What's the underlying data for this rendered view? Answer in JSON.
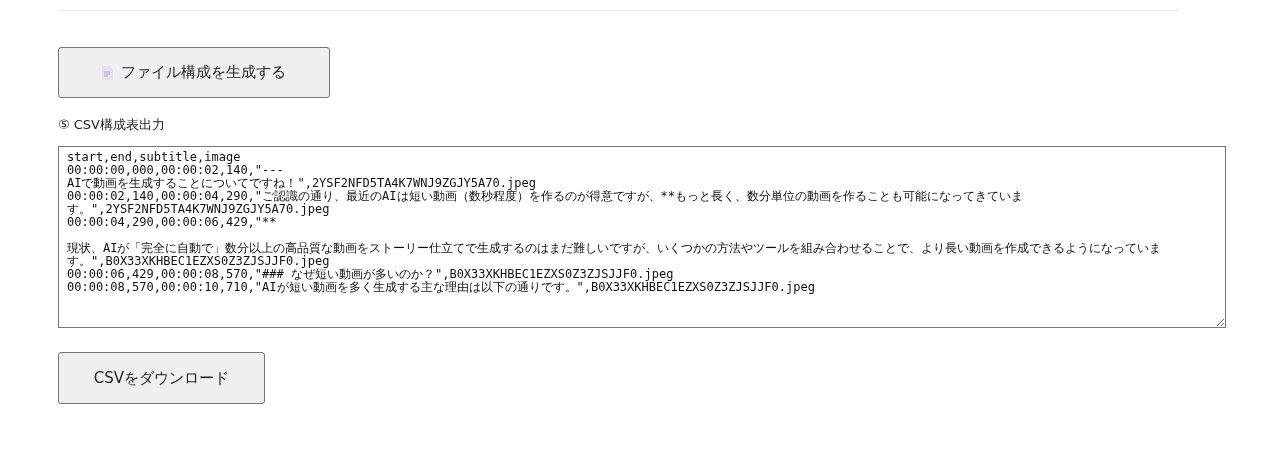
{
  "generate_button": {
    "label": "ファイル構成を生成する"
  },
  "csv_section": {
    "heading": "⑤ CSV構成表出力",
    "output": {
      "value": "start,end,subtitle,image\n00:00:00,000,00:00:02,140,\"---\nAIで動画を生成することについてですね！\",2YSF2NFD5TA4K7WNJ9ZGJY5A70.jpeg\n00:00:02,140,00:00:04,290,\"ご認識の通り、最近のAIは短い動画（数秒程度）を作るのが得意ですが、**もっと長く、数分単位の動画を作ることも可能になってきています。\",2YSF2NFD5TA4K7WNJ9ZGJY5A70.jpeg\n00:00:04,290,00:00:06,429,\"**\n\n現状、AIが「完全に自動で」数分以上の高品質な動画をストーリー仕立てで生成するのはまだ難しいですが、いくつかの方法やツールを組み合わせることで、より長い動画を作成できるようになっています。\",B0X33XKHBEC1EZXS0Z3ZJSJJF0.jpeg\n00:00:06,429,00:00:08,570,\"### なぜ短い動画が多いのか？\",B0X33XKHBEC1EZXS0Z3ZJSJJF0.jpeg\n00:00:08,570,00:00:10,710,\"AIが短い動画を多く生成する主な理由は以下の通りです。\",B0X33XKHBEC1EZXS0Z3ZJSJJF0.jpeg"
    },
    "download_button": {
      "label": "CSVをダウンロード"
    }
  }
}
